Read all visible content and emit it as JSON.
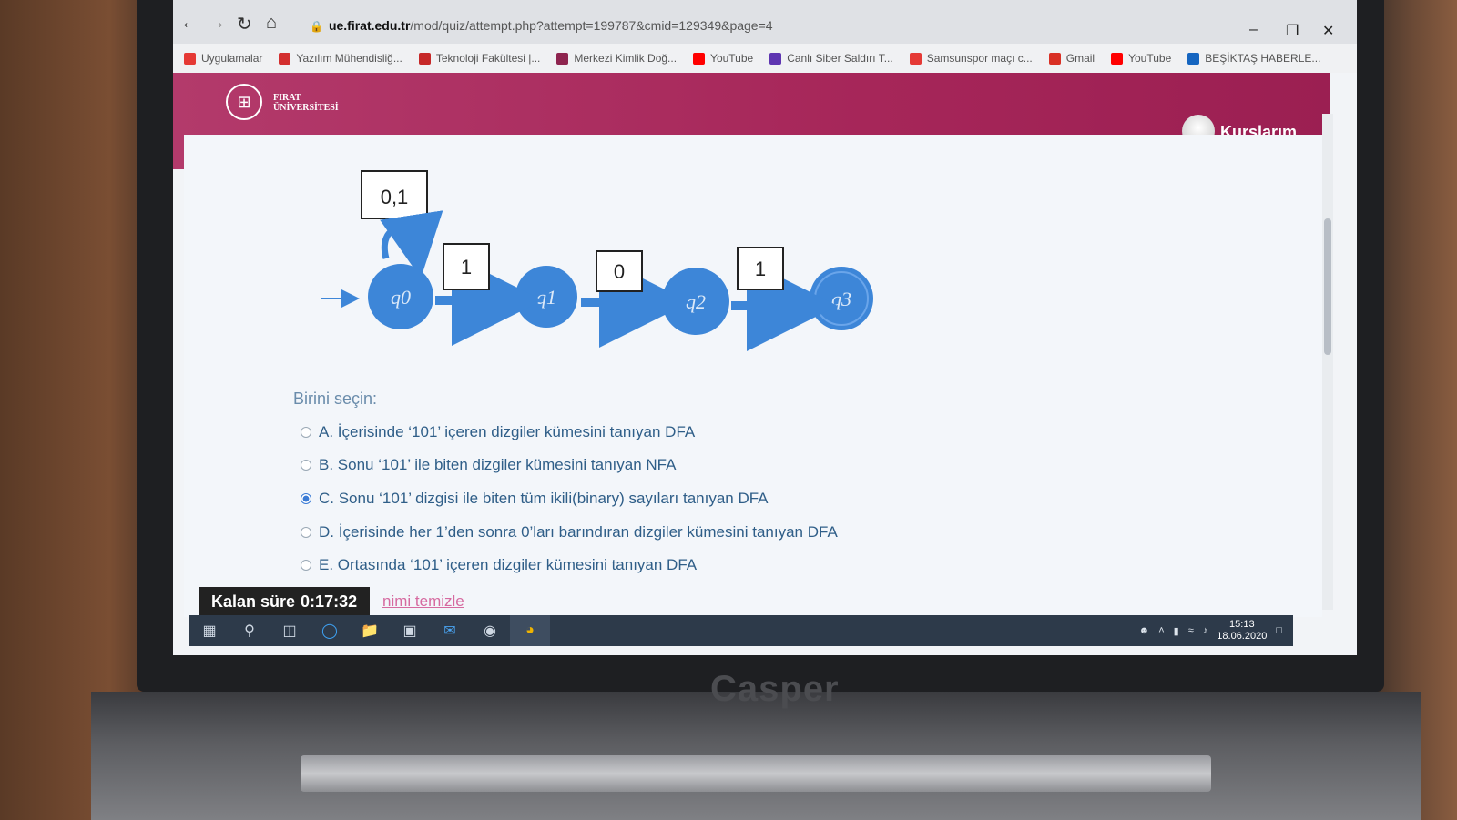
{
  "browser": {
    "url_host": "ue.firat.edu.tr",
    "url_path": "/mod/quiz/attempt.php?attempt=199787&cmid=129349&page=4",
    "bookmarks": [
      {
        "label": "Uygulamalar",
        "color": "#e53935"
      },
      {
        "label": "Yazılım Mühendisliğ...",
        "color": "#d32f2f"
      },
      {
        "label": "Teknoloji Fakültesi |...",
        "color": "#c62828"
      },
      {
        "label": "Merkezi Kimlik Doğ...",
        "color": "#8e244f"
      },
      {
        "label": "YouTube",
        "color": "#ff0000"
      },
      {
        "label": "Canlı Siber Saldırı T...",
        "color": "#5e35b1"
      },
      {
        "label": "Samsunspor maçı c...",
        "color": "#e53935"
      },
      {
        "label": "Gmail",
        "color": "#d93025"
      },
      {
        "label": "YouTube",
        "color": "#ff0000"
      },
      {
        "label": "BEŞİKTAŞ HABERLE...",
        "color": "#1565c0"
      }
    ]
  },
  "site": {
    "logo_line1": "FIRAT",
    "logo_line2": "ÜNİVERSİTESİ",
    "user_menu": "Kurslarım",
    "brand_color": "#a62659"
  },
  "dfa": {
    "self_loop_label": "0,1",
    "states": [
      "q0",
      "q1",
      "q2",
      "q3"
    ],
    "transitions": [
      "1",
      "0",
      "1"
    ]
  },
  "question": {
    "prompt": "Birini seçin:",
    "options": [
      {
        "label": "A. İçerisinde ‘101’ içeren dizgiler kümesini tanıyan DFA",
        "selected": false
      },
      {
        "label": "B. Sonu ‘101’ ile biten dizgiler kümesini tanıyan NFA",
        "selected": false
      },
      {
        "label": "C. Sonu ‘101’ dizgisi ile biten tüm ikili(binary) sayıları tanıyan DFA",
        "selected": true
      },
      {
        "label": "D. İçerisinde her 1’den sonra 0’ları barındıran dizgiler kümesini tanıyan DFA",
        "selected": false
      },
      {
        "label": "E. Ortasında ‘101’ içeren dizgiler kümesini tanıyan DFA",
        "selected": false
      }
    ],
    "clear_choice": "nimi temizle"
  },
  "timer": {
    "label": "Kalan süre",
    "value": "0:17:32"
  },
  "taskbar": {
    "time": "15:13",
    "date": "18.06.2020"
  },
  "laptop_brand": "Casper"
}
